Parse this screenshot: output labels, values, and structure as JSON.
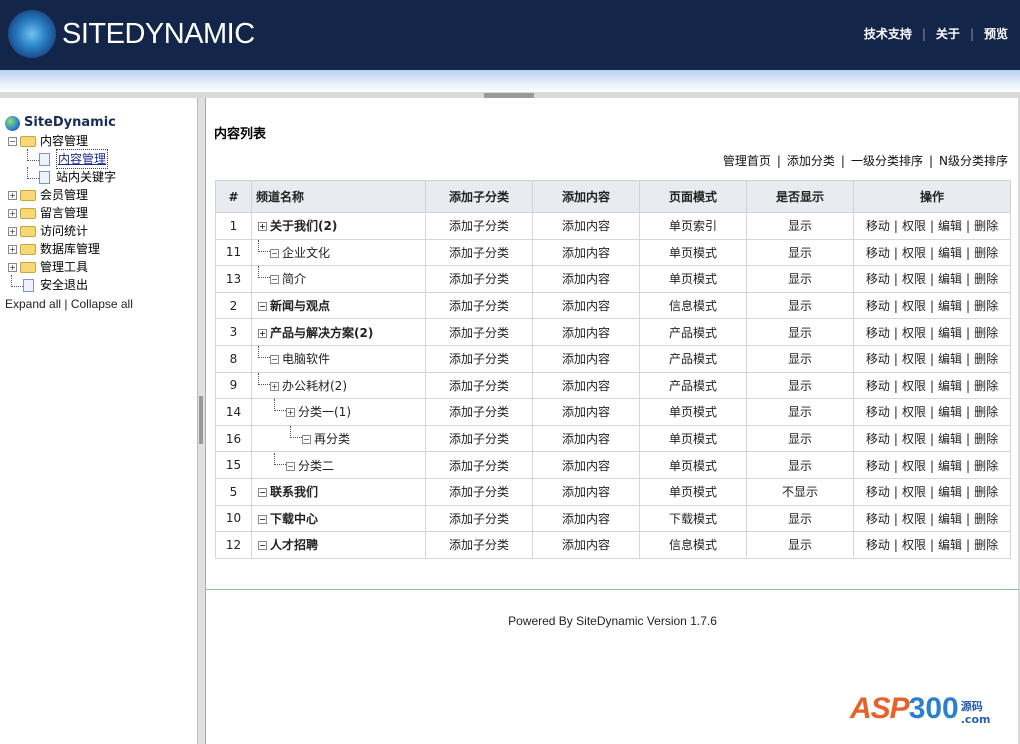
{
  "header": {
    "brand": "SITEDYNAMIC",
    "links": [
      "技术支持",
      "关于",
      "预览"
    ]
  },
  "sidebar": {
    "root": "SiteDynamic",
    "items": [
      {
        "label": "内容管理",
        "children": [
          "内容管理",
          "站内关键字"
        ]
      },
      {
        "label": "会员管理"
      },
      {
        "label": "留言管理"
      },
      {
        "label": "访问统计"
      },
      {
        "label": "数据库管理"
      },
      {
        "label": "管理工具"
      },
      {
        "label": "安全退出"
      }
    ],
    "expand_all": "Expand all",
    "collapse_all": "Collapse all"
  },
  "main": {
    "title": "内容列表",
    "actions": [
      "管理首页",
      "添加分类",
      "一级分类排序",
      "N级分类排序"
    ],
    "columns": [
      "#",
      "频道名称",
      "添加子分类",
      "添加内容",
      "页面模式",
      "是否显示",
      "操作"
    ],
    "ops": [
      "移动",
      "权限",
      "编辑",
      "删除"
    ],
    "rows": [
      {
        "id": "1",
        "name": "关于我们(2)",
        "add_sub": "添加子分类",
        "add_content": "添加内容",
        "mode": "单页索引",
        "show": "显示"
      },
      {
        "id": "11",
        "name": "企业文化",
        "add_sub": "添加子分类",
        "add_content": "添加内容",
        "mode": "单页模式",
        "show": "显示"
      },
      {
        "id": "13",
        "name": "简介",
        "add_sub": "添加子分类",
        "add_content": "添加内容",
        "mode": "单页模式",
        "show": "显示"
      },
      {
        "id": "2",
        "name": "新闻与观点",
        "add_sub": "添加子分类",
        "add_content": "添加内容",
        "mode": "信息模式",
        "show": "显示"
      },
      {
        "id": "3",
        "name": "产品与解决方案(2)",
        "add_sub": "添加子分类",
        "add_content": "添加内容",
        "mode": "产品模式",
        "show": "显示"
      },
      {
        "id": "8",
        "name": "电脑软件",
        "add_sub": "添加子分类",
        "add_content": "添加内容",
        "mode": "产品模式",
        "show": "显示"
      },
      {
        "id": "9",
        "name": "办公耗材(2)",
        "add_sub": "添加子分类",
        "add_content": "添加内容",
        "mode": "产品模式",
        "show": "显示"
      },
      {
        "id": "14",
        "name": "分类一(1)",
        "add_sub": "添加子分类",
        "add_content": "添加内容",
        "mode": "单页模式",
        "show": "显示"
      },
      {
        "id": "16",
        "name": "再分类",
        "add_sub": "添加子分类",
        "add_content": "添加内容",
        "mode": "单页模式",
        "show": "显示"
      },
      {
        "id": "15",
        "name": "分类二",
        "add_sub": "添加子分类",
        "add_content": "添加内容",
        "mode": "单页模式",
        "show": "显示"
      },
      {
        "id": "5",
        "name": "联系我们",
        "add_sub": "添加子分类",
        "add_content": "添加内容",
        "mode": "单页模式",
        "show": "不显示"
      },
      {
        "id": "10",
        "name": "下载中心",
        "add_sub": "添加子分类",
        "add_content": "添加内容",
        "mode": "下载模式",
        "show": "显示"
      },
      {
        "id": "12",
        "name": "人才招聘",
        "add_sub": "添加子分类",
        "add_content": "添加内容",
        "mode": "信息模式",
        "show": "显示"
      }
    ]
  },
  "footer": "Powered By SiteDynamic Version 1.7.6",
  "watermark": {
    "text": "ASP300",
    "suffix": "源码",
    "domain": ".com"
  }
}
